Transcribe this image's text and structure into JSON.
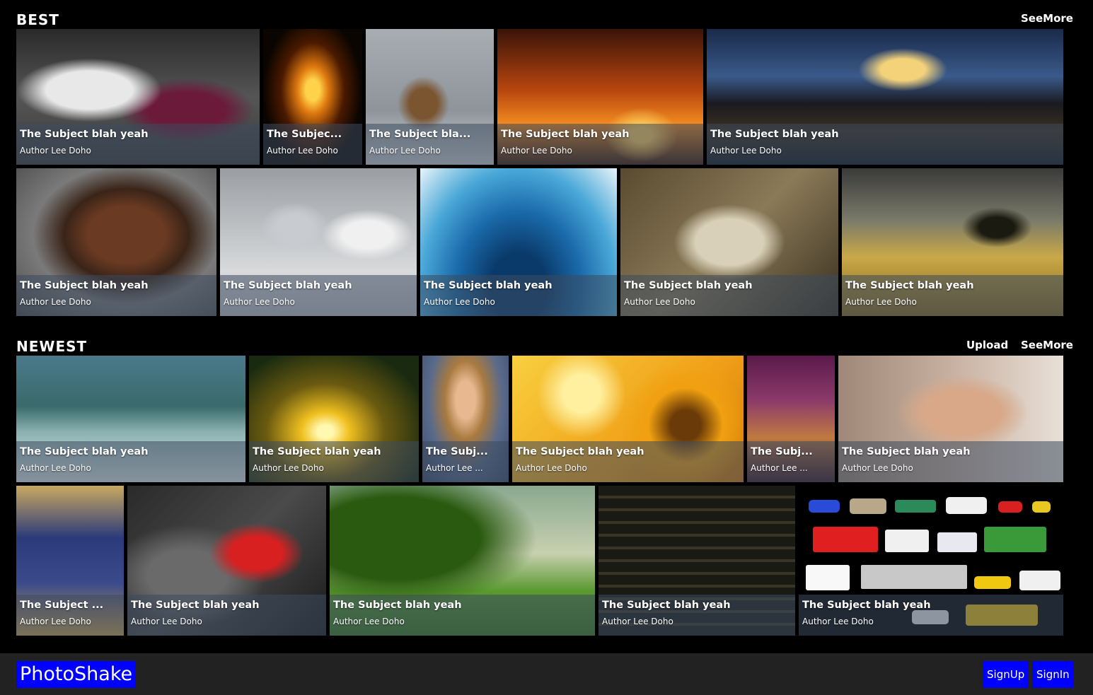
{
  "best": {
    "title": "BEST",
    "see_more": "SeeMore",
    "tiles": [
      {
        "subject": "The Subject blah yeah",
        "author": "Author Lee Doho",
        "image": "soccer-players-photo"
      },
      {
        "subject": "The Subjec...",
        "author": "Author Lee Doho",
        "image": "fire-sparks-photo"
      },
      {
        "subject": "The Subject bla...",
        "author": "Author Lee Doho",
        "image": "bears-photo"
      },
      {
        "subject": "The Subject blah yeah",
        "author": "Author Lee Doho",
        "image": "sunset-trees-photo"
      },
      {
        "subject": "The Subject blah yeah",
        "author": "Author Lee Doho",
        "image": "castle-night-photo"
      },
      {
        "subject": "The Subject blah yeah",
        "author": "Author Lee Doho",
        "image": "portrait-man-photo"
      },
      {
        "subject": "The Subject blah yeah",
        "author": "Author Lee Doho",
        "image": "lightbulb-robot-photo"
      },
      {
        "subject": "The Subject blah yeah",
        "author": "Author Lee Doho",
        "image": "ocean-fisheye-photo"
      },
      {
        "subject": "The Subject blah yeah",
        "author": "Author Lee Doho",
        "image": "drawing-hands-photo"
      },
      {
        "subject": "The Subject blah yeah",
        "author": "Author Lee Doho",
        "image": "field-tree-photo"
      }
    ]
  },
  "newest": {
    "title": "NEWEST",
    "upload": "Upload",
    "see_more": "SeeMore",
    "tiles": [
      {
        "subject": "The Subject blah yeah",
        "author": "Author Lee Doho",
        "image": "wave-surf-photo"
      },
      {
        "subject": "The Subject blah yeah",
        "author": "Author Lee Doho",
        "image": "sunset-jump-photo"
      },
      {
        "subject": "The Subj...",
        "author": "Author Lee ...",
        "image": "woman-portrait-photo"
      },
      {
        "subject": "The Subject blah yeah",
        "author": "Author Lee Doho",
        "image": "sunflowers-photo"
      },
      {
        "subject": "The Subj...",
        "author": "Author Lee ...",
        "image": "movie-poster-photo"
      },
      {
        "subject": "The Subject blah yeah",
        "author": "Author Lee Doho",
        "image": "selfie-man-photo"
      },
      {
        "subject": "The Subject ...",
        "author": "Author Lee Doho",
        "image": "team-photo"
      },
      {
        "subject": "The Subject blah yeah",
        "author": "Author Lee Doho",
        "image": "soccer-player-photo"
      },
      {
        "subject": "The Subject blah yeah",
        "author": "Author Lee Doho",
        "image": "green-tree-photo"
      },
      {
        "subject": "The Subject blah yeah",
        "author": "Author Lee Doho",
        "image": "film-infographic-photo"
      },
      {
        "subject": "The Subject blah yeah",
        "author": "Author Lee Doho",
        "image": "vehicles-illustration"
      }
    ]
  },
  "footer": {
    "logo": "PhotoShake",
    "signup": "SignUp",
    "signin": "SignIn"
  },
  "colors": {
    "background": "#000000",
    "footer": "#222222",
    "brand_blue": "#0000ff",
    "caption_overlay": "rgba(60,75,95,0.55)"
  }
}
